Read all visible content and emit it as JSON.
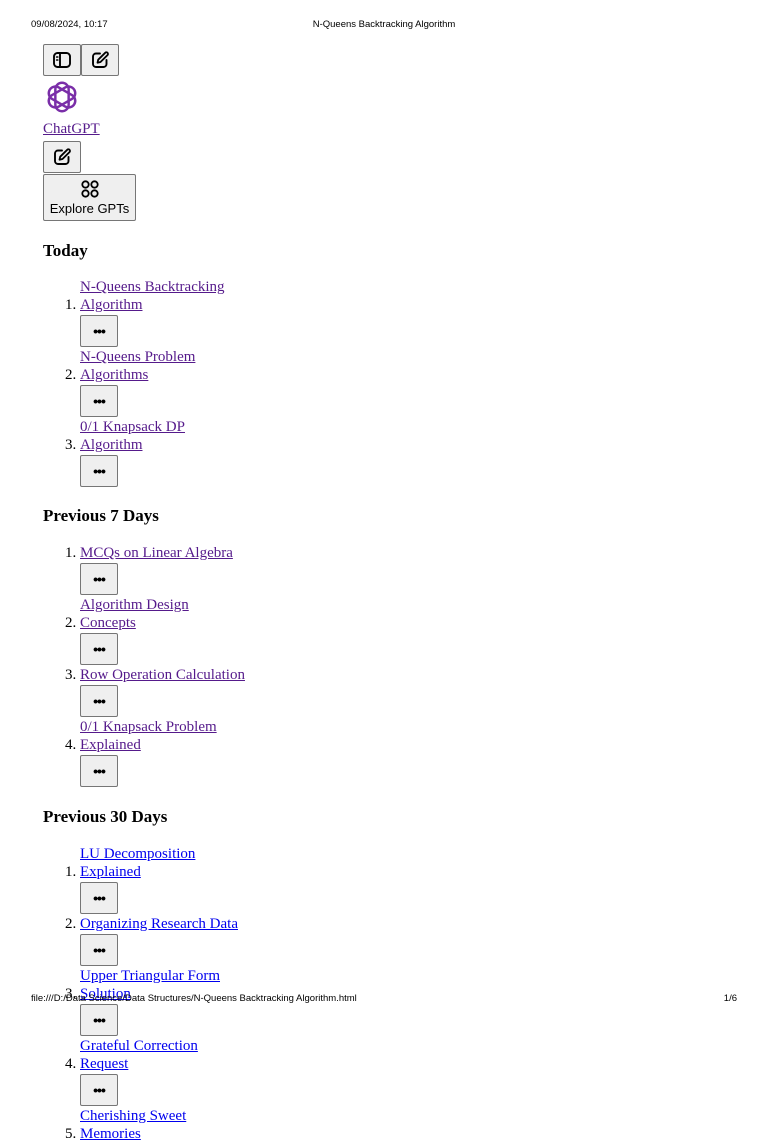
{
  "print": {
    "timestamp": "09/08/2024, 10:17",
    "title": "N-Queens Backtracking Algorithm",
    "file_path": "file:///D:/Data Science/Data Structures/N-Queens Backtracking Algorithm.html",
    "page": "1/6"
  },
  "brand": {
    "label": "ChatGPT"
  },
  "explore": {
    "label": "Explore GPTs"
  },
  "more_label": "•••",
  "colors": {
    "visited": "#551a8b",
    "unvisited": "#0000ee",
    "logo": "#7a2ea8",
    "button_bg": "#efefef"
  },
  "sections": [
    {
      "heading": "Today",
      "items": [
        {
          "title": "N-Queens Backtracking Algorithm",
          "visited": true
        },
        {
          "title": "N-Queens Problem Algorithms",
          "visited": true
        },
        {
          "title": "0/1 Knapsack DP Algorithm",
          "visited": true
        }
      ]
    },
    {
      "heading": "Previous 7 Days",
      "items": [
        {
          "title": "MCQs on Linear Algebra",
          "visited": true
        },
        {
          "title": "Algorithm Design Concepts",
          "visited": true
        },
        {
          "title": "Row Operation Calculation",
          "visited": true
        },
        {
          "title": "0/1 Knapsack Problem Explained",
          "visited": true
        }
      ]
    },
    {
      "heading": "Previous 30 Days",
      "items": [
        {
          "title": "LU Decomposition Explained",
          "visited": false
        },
        {
          "title": "Organizing Research Data",
          "visited": false
        },
        {
          "title": "Upper Triangular Form Solution",
          "visited": false
        },
        {
          "title": "Grateful Correction Request",
          "visited": false
        },
        {
          "title": "Cherishing Sweet Memories",
          "visited": false
        }
      ]
    }
  ]
}
